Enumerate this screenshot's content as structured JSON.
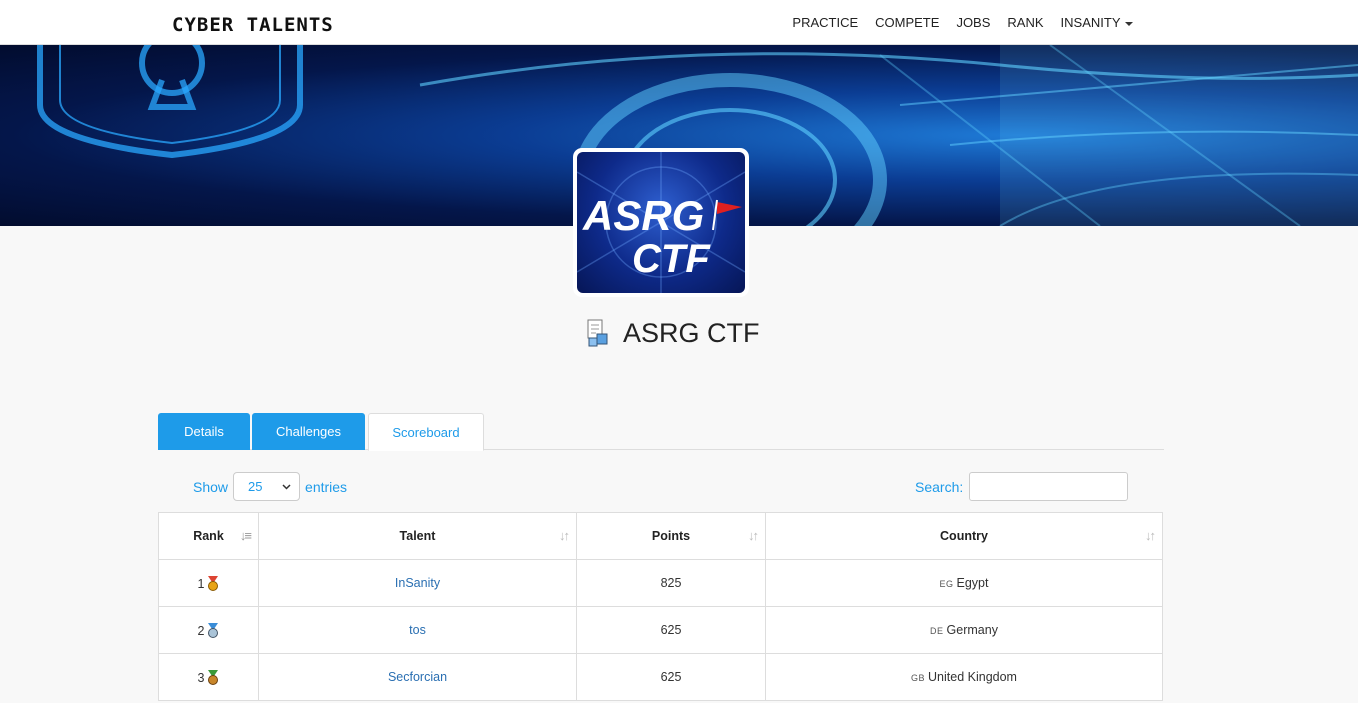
{
  "navbar": {
    "brand": "CYBER TALENTS",
    "links": [
      "PRACTICE",
      "COMPETE",
      "JOBS",
      "RANK",
      "INSANITY"
    ]
  },
  "logo": {
    "line1": "ASRG",
    "line2": "CTF"
  },
  "competition": {
    "title": "ASRG CTF"
  },
  "tabs": [
    {
      "label": "Details",
      "active": false
    },
    {
      "label": "Challenges",
      "active": false
    },
    {
      "label": "Scoreboard",
      "active": true
    }
  ],
  "controls": {
    "show_label": "Show",
    "entries_value": "25",
    "entries_label": "entries",
    "search_label": "Search:"
  },
  "table": {
    "headers": [
      "Rank",
      "Talent",
      "Points",
      "Country"
    ],
    "rows": [
      {
        "rank": "1",
        "talent": "InSanity",
        "points": "825",
        "cc": "EG",
        "country": "Egypt"
      },
      {
        "rank": "2",
        "talent": "tos",
        "points": "625",
        "cc": "DE",
        "country": "Germany"
      },
      {
        "rank": "3",
        "talent": "Secforcian",
        "points": "625",
        "cc": "GB",
        "country": "United Kingdom"
      }
    ]
  },
  "colors": {
    "accent": "#1e9be9",
    "link": "#2a6fb2",
    "banner": "#0b3d94"
  }
}
